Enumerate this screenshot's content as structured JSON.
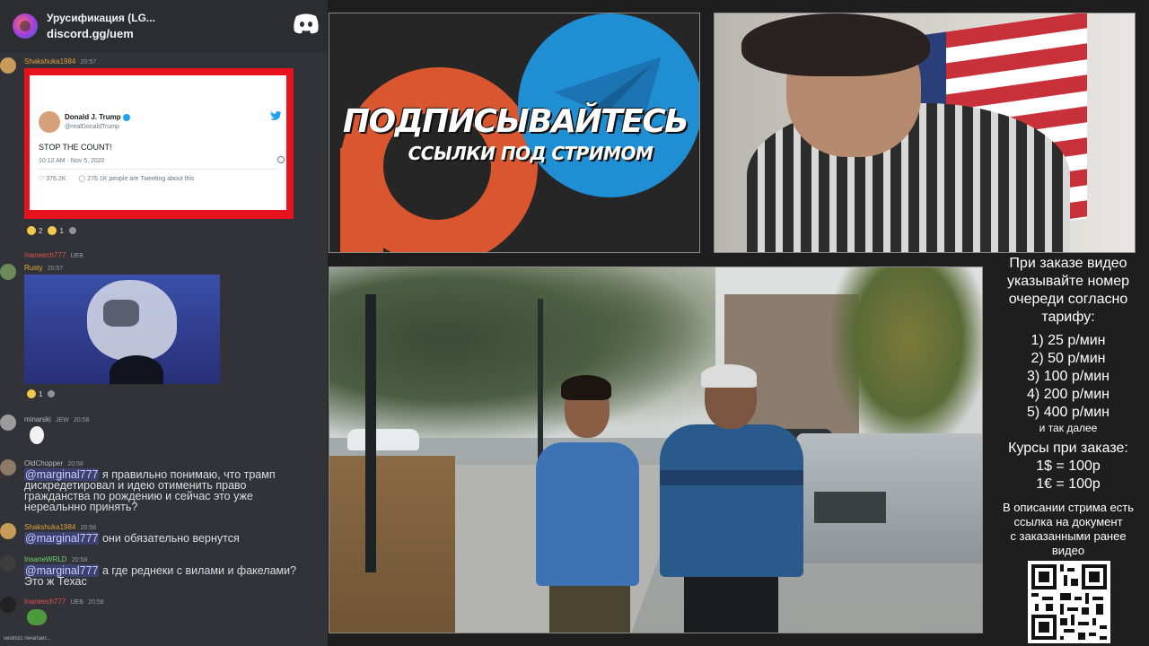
{
  "chat": {
    "server_title": "Урусификация (LG...",
    "server_invite": "discord.gg/uem",
    "messages": [
      {
        "author": "Shakshuka1984",
        "author_color": "#e0a23a",
        "time": "20:57",
        "tweet": {
          "name": "Donald J. Trump",
          "handle": "@realDonaldTrump",
          "text": "STOP THE COUNT!",
          "date": "10:12 AM · Nov 5, 2020",
          "likes": "376.2K",
          "tweeting": "276.1K people are Tweeting about this"
        },
        "reactions": [
          "2",
          "1"
        ]
      },
      {
        "reply_author": "Inaneech777",
        "reply_tag": "UEB",
        "author": "Rusty",
        "author_color": "#e8b13a",
        "time": "20:57",
        "reactions": [
          "1"
        ]
      },
      {
        "author": "minarski",
        "author_color": "#b5bac1",
        "tag": "JEW",
        "time": "20:58"
      },
      {
        "author": "OldChopper",
        "author_color": "#b5bac1",
        "time": "20:58",
        "mention": "@marginal777",
        "lines": [
          "я правильно понимаю, что трамп",
          "дискредетировал и идею отименить право",
          "гражданства по рождению и сейчас это уже",
          "нереальнно принять?"
        ]
      },
      {
        "author": "Shakshuka1984",
        "author_color": "#e0a23a",
        "time": "20:58",
        "mention": "@marginal777",
        "lines": [
          "они обязательно вернутся"
        ]
      },
      {
        "author": "InsaneWRLD",
        "author_color": "#6fd36f",
        "time": "20:58",
        "mention": "@marginal777",
        "lines": [
          "а где реднеки с вилами и факелами?",
          "Это ж Техас"
        ]
      },
      {
        "author": "Inaneech777",
        "author_color": "#e05050",
        "tag": "UEB",
        "time": "20:58"
      }
    ],
    "typing": "vestnizc печатает..."
  },
  "banner": {
    "line1": "ПОДПИСЫВАЙТЕСЬ",
    "line2": "ССЫЛКИ ПОД СТРИМОМ",
    "patreon_color": "#d9562f",
    "telegram_color": "#1f8ed3"
  },
  "info": {
    "intro": [
      "При заказе видео",
      "указывайте номер",
      "очереди согласно",
      "тарифу:"
    ],
    "prices": [
      "1) 25 р/мин",
      "2) 50 р/мин",
      "3) 100 р/мин",
      "4) 200 р/мин",
      "5) 400 р/мин"
    ],
    "prices_more": "и так далее",
    "rates_title": "Курсы при заказе:",
    "rates": [
      "1$ = 100р",
      "1€ = 100р"
    ],
    "note": [
      "В описании стрима есть",
      "ссылка на документ",
      "с заказанными ранее",
      "видео"
    ]
  },
  "icons": {
    "discord": "discord-logo-icon",
    "twitter": "twitter-bird-icon",
    "verified": "verified-badge-icon"
  }
}
